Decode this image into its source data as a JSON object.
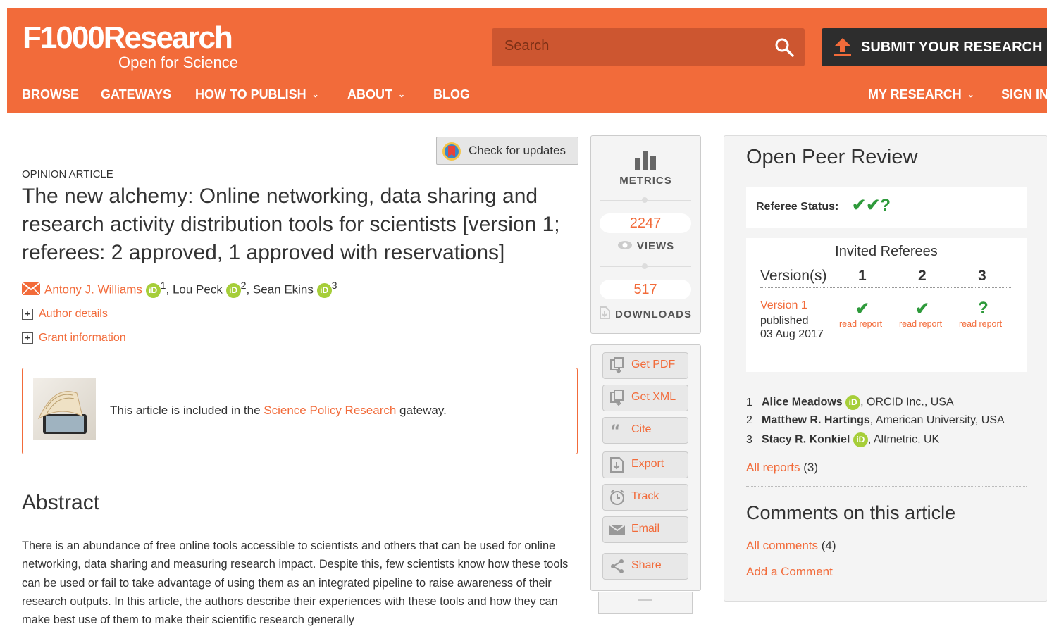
{
  "header": {
    "logo_main": "F1000Research",
    "logo_sub": "Open for Science",
    "search_placeholder": "Search",
    "submit_label": "SUBMIT YOUR RESEARCH",
    "nav": {
      "browse": "BROWSE",
      "gateways": "GATEWAYS",
      "how_to_publish": "HOW TO PUBLISH",
      "about": "ABOUT",
      "blog": "BLOG",
      "my_research": "MY RESEARCH",
      "sign_in": "SIGN IN"
    },
    "brand_color": "#f26b3a"
  },
  "article": {
    "check_updates": "Check for updates",
    "type": "OPINION ARTICLE",
    "title": "The new alchemy: Online networking, data sharing and research activity distribution tools for scientists [version 1; referees: 2 approved, 1 approved with reservations]",
    "authors": [
      {
        "name": "Antony J. Williams",
        "aff": "1"
      },
      {
        "name": "Lou Peck",
        "aff": "2"
      },
      {
        "name": "Sean Ekins",
        "aff": "3"
      }
    ],
    "author_details": "Author details",
    "grant_information": "Grant information",
    "gateway_prefix": "This article is included in the ",
    "gateway_link": "Science Policy Research",
    "gateway_suffix": " gateway.",
    "abstract_heading": "Abstract",
    "abstract_text": "There is an abundance of free online tools accessible to scientists and others that can be used for online networking, data sharing and measuring research impact. Despite this, few scientists know how these tools can be used or fail to take advantage of using them as an integrated pipeline to raise awareness of their research outputs. In this article, the authors describe their experiences with these tools and how they can make best use of them to make their scientific research generally"
  },
  "metrics": {
    "label": "METRICS",
    "views_count": "2247",
    "views_label": "VIEWS",
    "downloads_count": "517",
    "downloads_label": "DOWNLOADS"
  },
  "actions": {
    "get_pdf": "Get PDF",
    "get_xml": "Get XML",
    "cite": "Cite",
    "export": "Export",
    "track": "Track",
    "email": "Email",
    "share": "Share"
  },
  "review": {
    "heading": "Open Peer Review",
    "referee_status_label": "Referee Status:",
    "status_marks": "✔✔?",
    "invited_heading": "Invited Referees",
    "versions_label": "Version(s)",
    "referee_numbers": [
      "1",
      "2",
      "3"
    ],
    "version_link": "Version 1",
    "published_label": "published",
    "published_date": "03 Aug 2017",
    "report_marks": [
      "✔",
      "✔",
      "?"
    ],
    "read_report": "read report",
    "referees": [
      {
        "num": "1",
        "name": "Alice Meadows",
        "orcid": true,
        "aff": ", ORCID Inc., USA"
      },
      {
        "num": "2",
        "name": "Matthew R. Hartings",
        "orcid": false,
        "aff": ", American University, USA"
      },
      {
        "num": "3",
        "name": "Stacy R. Konkiel",
        "orcid": true,
        "aff": ", Altmetric, UK"
      }
    ],
    "all_reports_link": "All reports",
    "all_reports_count": "(3)",
    "comments_heading": "Comments on this article",
    "all_comments_link": "All comments",
    "all_comments_count": "(4)",
    "add_comment": "Add a Comment"
  }
}
